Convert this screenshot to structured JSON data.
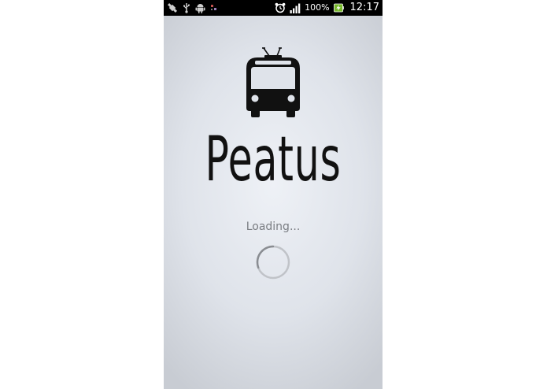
{
  "status_bar": {
    "battery_percent": "100%",
    "clock": "12:17",
    "left_icons": [
      "satellite-icon",
      "usb-icon",
      "android-debug-icon",
      "notification-icon"
    ],
    "right_icons": [
      "alarm-icon",
      "signal-icon",
      "battery-charging-icon"
    ]
  },
  "app": {
    "name": "Peatus",
    "loading_text": "Loading..."
  },
  "colors": {
    "status_bar_bg": "#000000",
    "screen_bg": "#dfe3ea",
    "logo_color": "#111111",
    "loading_text_color": "#7a7d82",
    "spinner_track": "#c0c3c8",
    "spinner_arc": "#8a8d92"
  },
  "icons": {
    "logo": "trolleybus-icon",
    "progress": "spinner-icon"
  }
}
